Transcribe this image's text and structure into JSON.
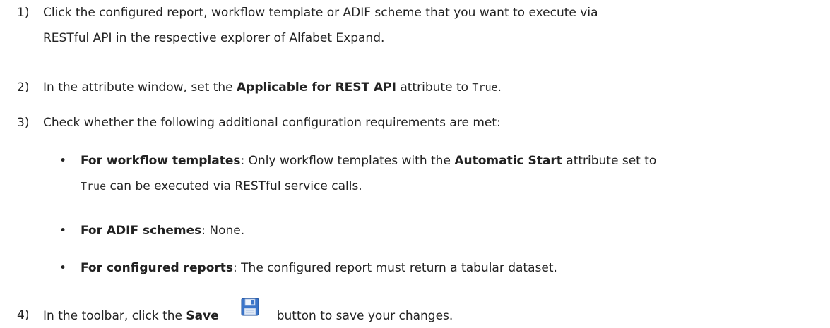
{
  "steps": [
    {
      "num": "1)",
      "line1": "Click the configured report, workflow template or ADIF scheme that you want to execute via",
      "line2": "RESTful API in the respective explorer of Alfabet Expand."
    },
    {
      "num": "2)",
      "pre": "In the attribute window, set the ",
      "bold": "Applicable for REST API",
      "mid": " attribute to ",
      "code": "True",
      "post": "."
    },
    {
      "num": "3)",
      "text": "Check whether the following additional configuration requirements are met:"
    },
    {
      "num": "4)",
      "pre": "In the toolbar, click the ",
      "bold": "Save",
      "post": "button to save your changes."
    }
  ],
  "bullets": [
    {
      "bold": "For workflow templates",
      "text1": ": Only workflow templates with the ",
      "bold2": "Automatic Start",
      "text2": " attribute set to",
      "code": "True",
      "text3": " can be executed via RESTful service calls."
    },
    {
      "bold": "For ADIF schemes",
      "text1": ": None."
    },
    {
      "bold": "For configured reports",
      "text1": ": The configured report must return a tabular dataset."
    }
  ],
  "bullet_glyph": "•",
  "icon": "save-disk-icon",
  "colors": {
    "text": "#222222",
    "icon_blue": "#3a74c9"
  }
}
